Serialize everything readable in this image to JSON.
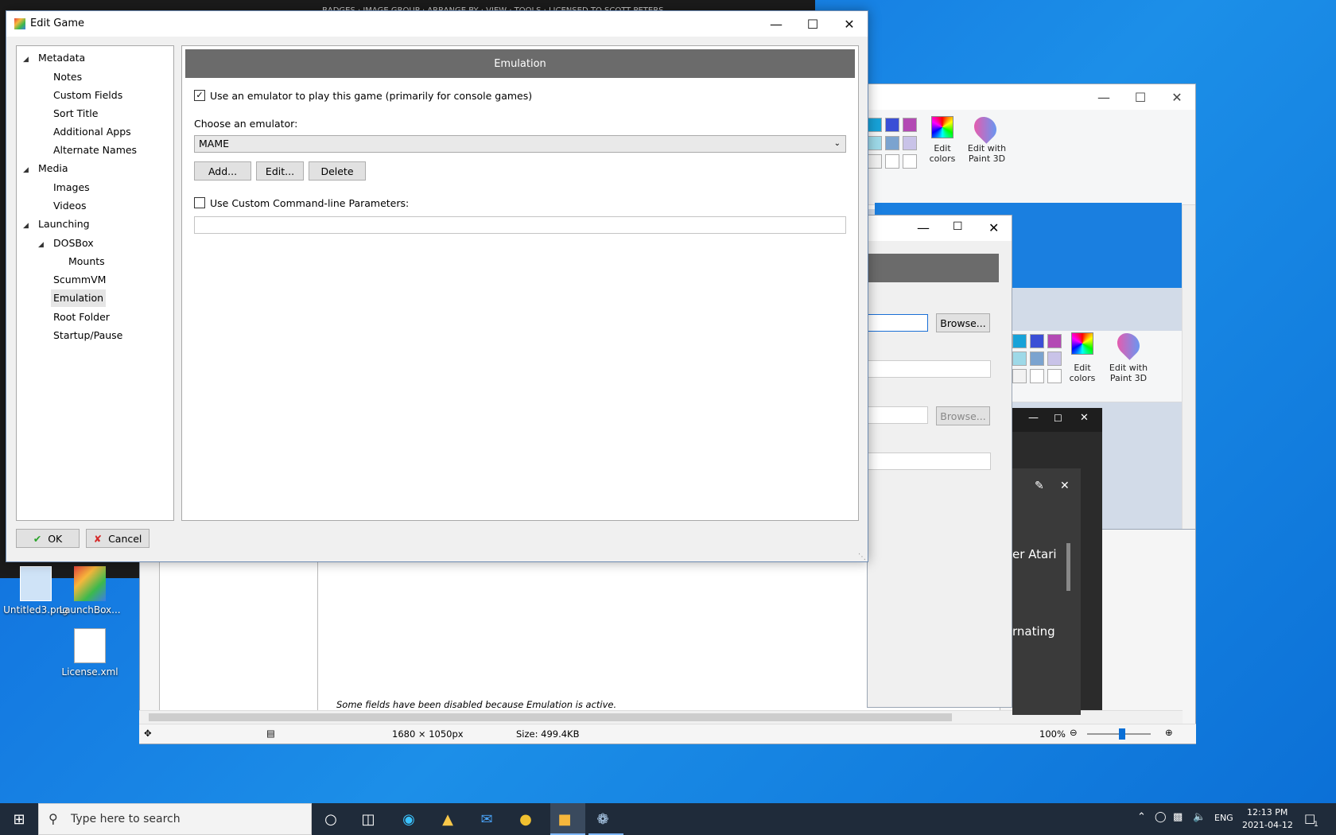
{
  "dialog": {
    "title": "Edit Game",
    "panel_header": "Emulation",
    "use_emulator_label": "Use an emulator to play this game (primarily for console games)",
    "use_emulator_checked": true,
    "choose_emulator_label": "Choose an emulator:",
    "emulator_value": "MAME",
    "add_label": "Add...",
    "edit_label": "Edit...",
    "delete_label": "Delete",
    "custom_cmd_label": "Use Custom Command-line Parameters:",
    "custom_cmd_checked": false,
    "custom_cmd_value": "",
    "ok_label": "OK",
    "cancel_label": "Cancel"
  },
  "tree": {
    "metadata": "Metadata",
    "notes": "Notes",
    "custom_fields": "Custom Fields",
    "sort_title": "Sort Title",
    "additional_apps": "Additional Apps",
    "alternate_names": "Alternate Names",
    "media": "Media",
    "images": "Images",
    "videos": "Videos",
    "launching": "Launching",
    "dosbox": "DOSBox",
    "mounts": "Mounts",
    "scummvm": "ScummVM",
    "emulation": "Emulation",
    "root_folder": "Root Folder",
    "startup_pause": "Startup/Pause"
  },
  "background": {
    "top_menu": "BADGES  ·  IMAGE GROUP  ·  ARRANGE BY  ·  VIEW  ·  TOOLS  ·  LICENSED TO SCOTT PETERS",
    "edit_colors": "Edit\ncolors",
    "edit_paint3d": "Edit with\nPaint 3D",
    "browse": "Browse...",
    "atari_fragment": "er Atari",
    "nating_fragment": "rnating",
    "disabled_note": "Some fields have been disabled because Emulation is active.",
    "status_dims": "1680 × 1050px",
    "status_size": "Size: 499.4KB",
    "zoom": "100%",
    "swatch_colors": [
      "#3a4fd6",
      "#b34ab4",
      "#7ba3cf",
      "#c9c3e8",
      "#f2f2f2",
      "#ffffff"
    ]
  },
  "desktop": {
    "icon1": "Untitled3.png",
    "icon2": "LaunchBox...",
    "icon3": "License.xml"
  },
  "taskbar": {
    "search_placeholder": "Type here to search",
    "lang": "ENG",
    "time": "12:13 PM",
    "date": "2021-04-12",
    "notif_count": "1"
  }
}
